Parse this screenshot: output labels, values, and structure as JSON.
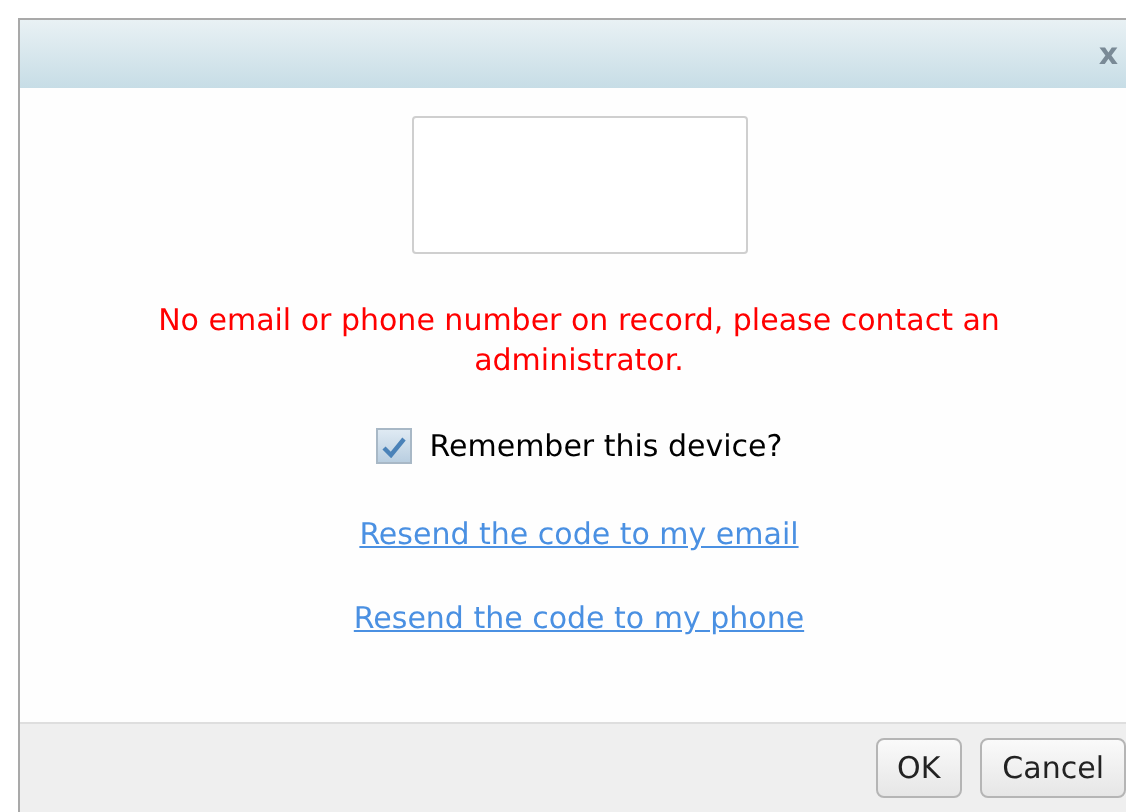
{
  "dialog": {
    "close_button": "x",
    "message": "No email or phone number on record, please contact an administrator.",
    "remember_device": {
      "label": "Remember this device?",
      "checked": true
    },
    "links": [
      "Resend the code to my email",
      "Resend the code to my phone"
    ],
    "buttons": [
      "OK",
      "Cancel"
    ]
  }
}
